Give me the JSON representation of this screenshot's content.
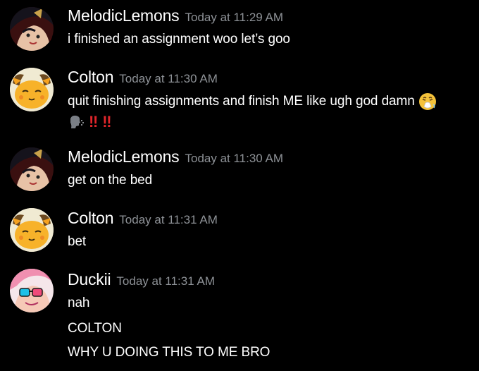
{
  "messages": [
    {
      "username": "MelodicLemons",
      "timestamp": "Today at 11:29 AM",
      "lines": [
        "i finished an assignment woo let’s goo"
      ]
    },
    {
      "username": "Colton",
      "timestamp": "Today at 11:30 AM",
      "lines": [
        "quit finishing assignments and finish ME like ugh god damn"
      ],
      "emojis": [
        "sneezing-face-emoji",
        "speaking-head-emoji",
        "double-exclamation-emoji",
        "double-exclamation-emoji"
      ],
      "bang_text": "‼"
    },
    {
      "username": "MelodicLemons",
      "timestamp": "Today at 11:30 AM",
      "lines": [
        "get on the bed"
      ]
    },
    {
      "username": "Colton",
      "timestamp": "Today at 11:31 AM",
      "lines": [
        "bet"
      ]
    },
    {
      "username": "Duckii",
      "timestamp": "Today at 11:31 AM",
      "lines": [
        "nah",
        "COLTON",
        "WHY U DOING THIS TO ME BRO"
      ]
    }
  ],
  "colors": {
    "background": "#000000",
    "username": "#ffffff",
    "timestamp": "#8e9297",
    "message_text": "#ffffff",
    "exclamation": "#e0262b"
  },
  "avatars": {
    "MelodicLemons": "anime-character-avatar",
    "Colton": "yellow-mouse-avatar",
    "Duckii": "pink-character-avatar"
  }
}
